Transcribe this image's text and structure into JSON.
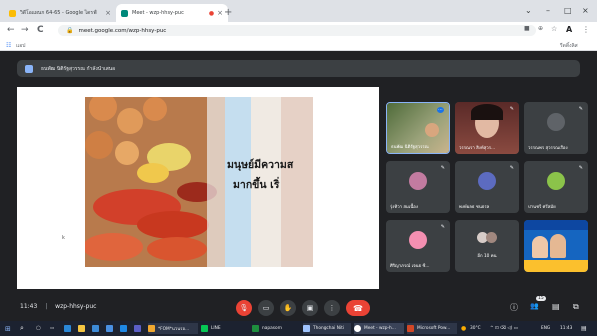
{
  "browser": {
    "tabs": [
      {
        "title": "วิดีโอแผนก 64-65 - Google ไดรฟ์",
        "close": "×",
        "favicon_color": "#fbbc04"
      },
      {
        "title": "Meet - wzp-hhsy-puc",
        "close": "×",
        "favicon_color": "#00897b"
      }
    ],
    "recording_dot": "●",
    "tab2_close": "×",
    "new_tab": "+",
    "window_controls": {
      "minimize": "⌄",
      "restore": "–",
      "maximize": "□",
      "close": "×"
    },
    "nav": {
      "back": "←",
      "forward": "→",
      "reload": "C"
    },
    "url": "meet.google.com/wzp-hhsy-puc",
    "bookmarks_label": "แอป",
    "reading_list": "รีดดิ้งลิส"
  },
  "meet": {
    "presenter_banner": "ธนพัฒ นิติรัฐสุวรรณ กำลังนำเสนอ",
    "slide": {
      "line1": "มนุษย์มีความส",
      "line2": "มากขึ้น เริ่",
      "cursor": "k"
    },
    "participants": [
      {
        "name": "ธนพัฒ นิติรัฐสุวรรณ",
        "kind": "video",
        "mic": "⋯"
      },
      {
        "name": "วรรณรา สิงห์สุวร...",
        "kind": "video",
        "mic": "✎"
      },
      {
        "name": "วรรณพร สุวรรณเรือง",
        "kind": "avatar",
        "mic": "✎",
        "avatar_color": "#5f6368"
      },
      {
        "name": "รุ่งทิวา สมเนื้อง",
        "kind": "avatar",
        "mic": "✎",
        "avatar_color": "#c27ba0"
      },
      {
        "name": "พงษ์ผลธ ชนธรล",
        "kind": "avatar",
        "mic": "✎",
        "avatar_color": "#5c6bc0"
      },
      {
        "name": "ปานชรี ศรีสมัย",
        "kind": "avatar",
        "mic": "✎",
        "avatar_color": "#8bc34a"
      },
      {
        "name": "ศิริญาภรณ์ เจนธ ซี...",
        "kind": "avatar",
        "mic": "✎",
        "avatar_color": "#f48fb1"
      },
      {
        "name": "อีก 10 คน",
        "kind": "group",
        "mic": ""
      },
      {
        "name": "",
        "kind": "banner",
        "mic": ""
      }
    ],
    "time": "11:43",
    "separator": "|",
    "meeting_code": "wzp-hhsy-puc",
    "controls": {
      "mic": "🎙",
      "camera": "▭",
      "raise": "✋",
      "present": "▣",
      "more": "⋮",
      "end": "☎"
    },
    "right_icons": {
      "info": "ⓘ",
      "people": "👥",
      "chat": "▤",
      "activities": "⧉"
    },
    "people_count": "15"
  },
  "taskbar": {
    "start": "⊞",
    "search": "⌕",
    "items": [
      "*FOM*นวนรอ...",
      "LINE",
      "napasorn",
      "Thongchai Niti",
      "Meet - wzp-h...",
      "Microsoft Pow..."
    ],
    "weather": "30°C",
    "lang": "ENG",
    "clock": "11:43"
  },
  "colors": {
    "accent": "#8ab4f8",
    "end_call": "#ea4335",
    "meet_bg": "#202124"
  }
}
